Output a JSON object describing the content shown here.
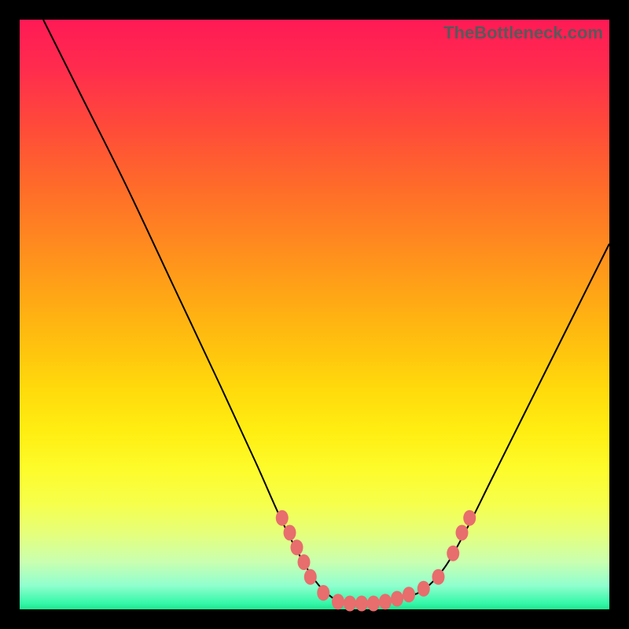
{
  "watermark": "TheBottleneck.com",
  "chart_data": {
    "type": "line",
    "title": "",
    "xlabel": "",
    "ylabel": "",
    "xlim": [
      0,
      100
    ],
    "ylim": [
      0,
      100
    ],
    "series": [
      {
        "name": "bottleneck-curve",
        "x": [
          4,
          10,
          18,
          26,
          34,
          40,
          44,
          47,
          50,
          53,
          56,
          60,
          64,
          68,
          72,
          76,
          80,
          85,
          90,
          95,
          100
        ],
        "values": [
          100,
          88,
          72,
          55,
          38,
          25,
          16,
          10,
          5,
          2,
          1,
          1,
          2,
          3,
          7,
          14,
          22,
          32,
          42,
          52,
          62
        ]
      }
    ],
    "markers": {
      "name": "accent-points",
      "x": [
        44.5,
        45.8,
        47.0,
        48.2,
        49.3,
        51.5,
        54.0,
        56.0,
        58.0,
        60.0,
        62.0,
        64.0,
        66.0,
        68.5,
        71.0,
        73.5,
        75.0,
        76.3
      ],
      "values": [
        15.5,
        13.0,
        10.5,
        8.0,
        5.5,
        2.8,
        1.3,
        1.0,
        1.0,
        1.0,
        1.3,
        1.8,
        2.5,
        3.5,
        5.5,
        9.5,
        13.0,
        15.5
      ]
    },
    "gradient_stops": [
      {
        "pos": 0,
        "color": "#ff1a55"
      },
      {
        "pos": 50,
        "color": "#ffaa14"
      },
      {
        "pos": 75,
        "color": "#fdfb2a"
      },
      {
        "pos": 100,
        "color": "#1de58e"
      }
    ]
  }
}
